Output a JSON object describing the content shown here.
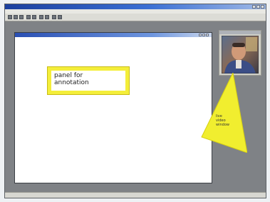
{
  "app": {
    "title": "",
    "menus": [
      "",
      "",
      "",
      "",
      "",
      "",
      ""
    ],
    "status": ""
  },
  "document": {
    "title": ""
  },
  "annotation_panel": {
    "text": "panel for\nannotation"
  },
  "video_window": {
    "label": "live\nvideo\nwindow"
  },
  "icons": [
    "minimize-icon",
    "maximize-icon",
    "close-icon",
    "toolbar-icon"
  ],
  "colors": {
    "titlebar": "#1b3f9e",
    "annotation_yellow": "#f4ee3a",
    "workspace_gray": "#7f8286",
    "document_white": "#ffffff"
  }
}
